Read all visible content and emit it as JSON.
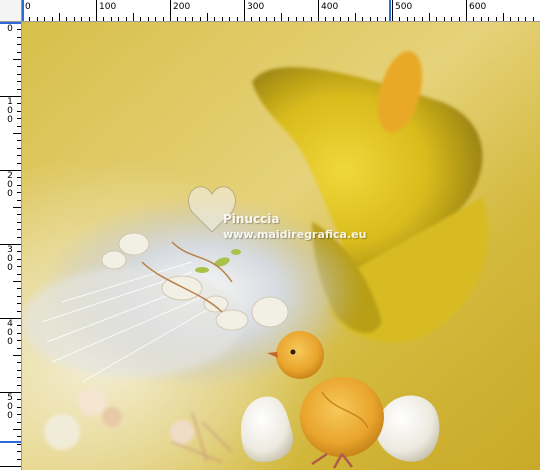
{
  "ruler": {
    "horizontal_labels": [
      "0",
      "100",
      "200",
      "300",
      "400",
      "500",
      "600"
    ],
    "vertical_labels": [
      "0",
      "100",
      "200",
      "300",
      "400",
      "500"
    ]
  },
  "canvas": {
    "watermark_name": "Pinuccia",
    "watermark_url": "www.maidiregrafica.eu",
    "colors": {
      "background": "#d9c247",
      "calla_lily": "#e5cc2b",
      "chick": "#f0b83a",
      "accent_blue": "#2f6ad6"
    }
  }
}
